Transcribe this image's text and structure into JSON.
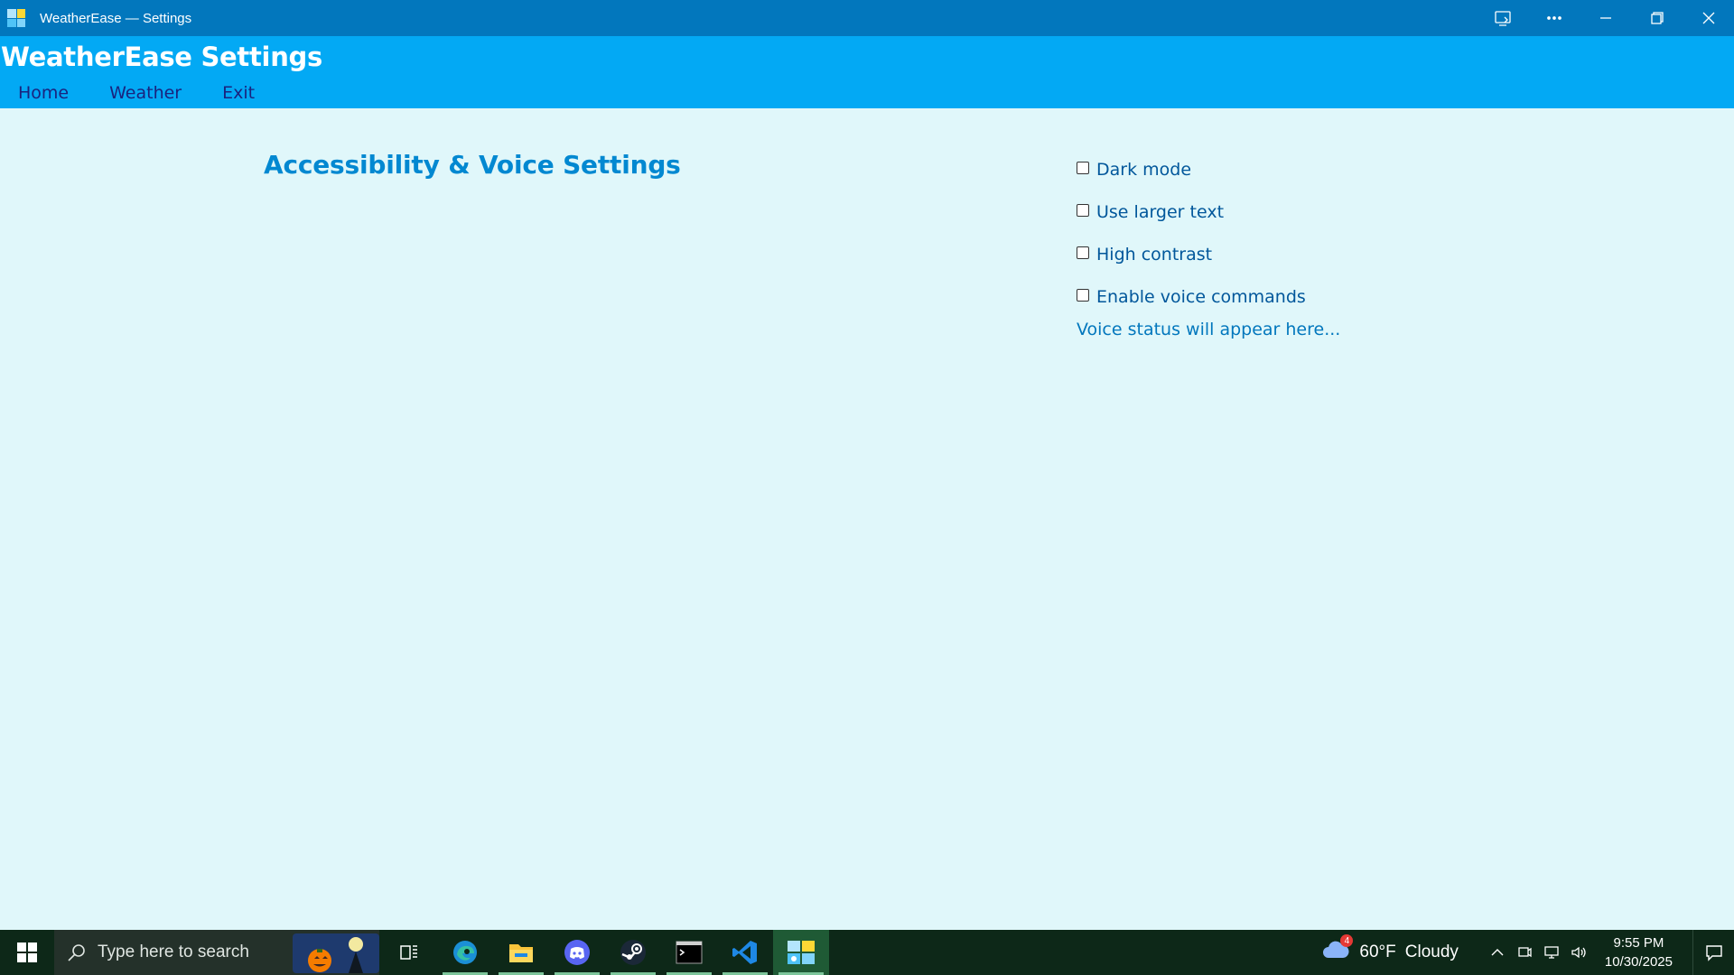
{
  "window": {
    "title": "WeatherEase — Settings",
    "icon": "weatherease-app-icon"
  },
  "window_controls": [
    "cast-icon",
    "more-icon",
    "minimize-icon",
    "restore-icon",
    "close-icon"
  ],
  "header": {
    "title": "WeatherEase Settings",
    "nav": [
      {
        "label": "Home"
      },
      {
        "label": "Weather"
      },
      {
        "label": "Exit"
      }
    ]
  },
  "main": {
    "heading": "Accessibility & Voice Settings",
    "options": [
      {
        "label": "Dark mode",
        "checked": false
      },
      {
        "label": "Use larger text",
        "checked": false
      },
      {
        "label": "High contrast",
        "checked": false
      },
      {
        "label": "Enable voice commands",
        "checked": false
      }
    ],
    "voice_status": "Voice status will appear here..."
  },
  "taskbar": {
    "search_placeholder": "Type here to search",
    "apps": [
      "task-view-icon",
      "edge-icon",
      "file-explorer-icon",
      "discord-icon",
      "steam-icon",
      "terminal-icon",
      "vscode-icon",
      "weatherease-icon"
    ],
    "weather": {
      "temp": "60°F",
      "condition": "Cloudy",
      "badge": "4"
    },
    "time": "9:55 PM",
    "date": "10/30/2025"
  },
  "colors": {
    "titlebar": "#0277bd",
    "header": "#03a9f4",
    "background": "#e0f7fa",
    "heading": "#0288d1",
    "taskbar": "#0d2818"
  }
}
